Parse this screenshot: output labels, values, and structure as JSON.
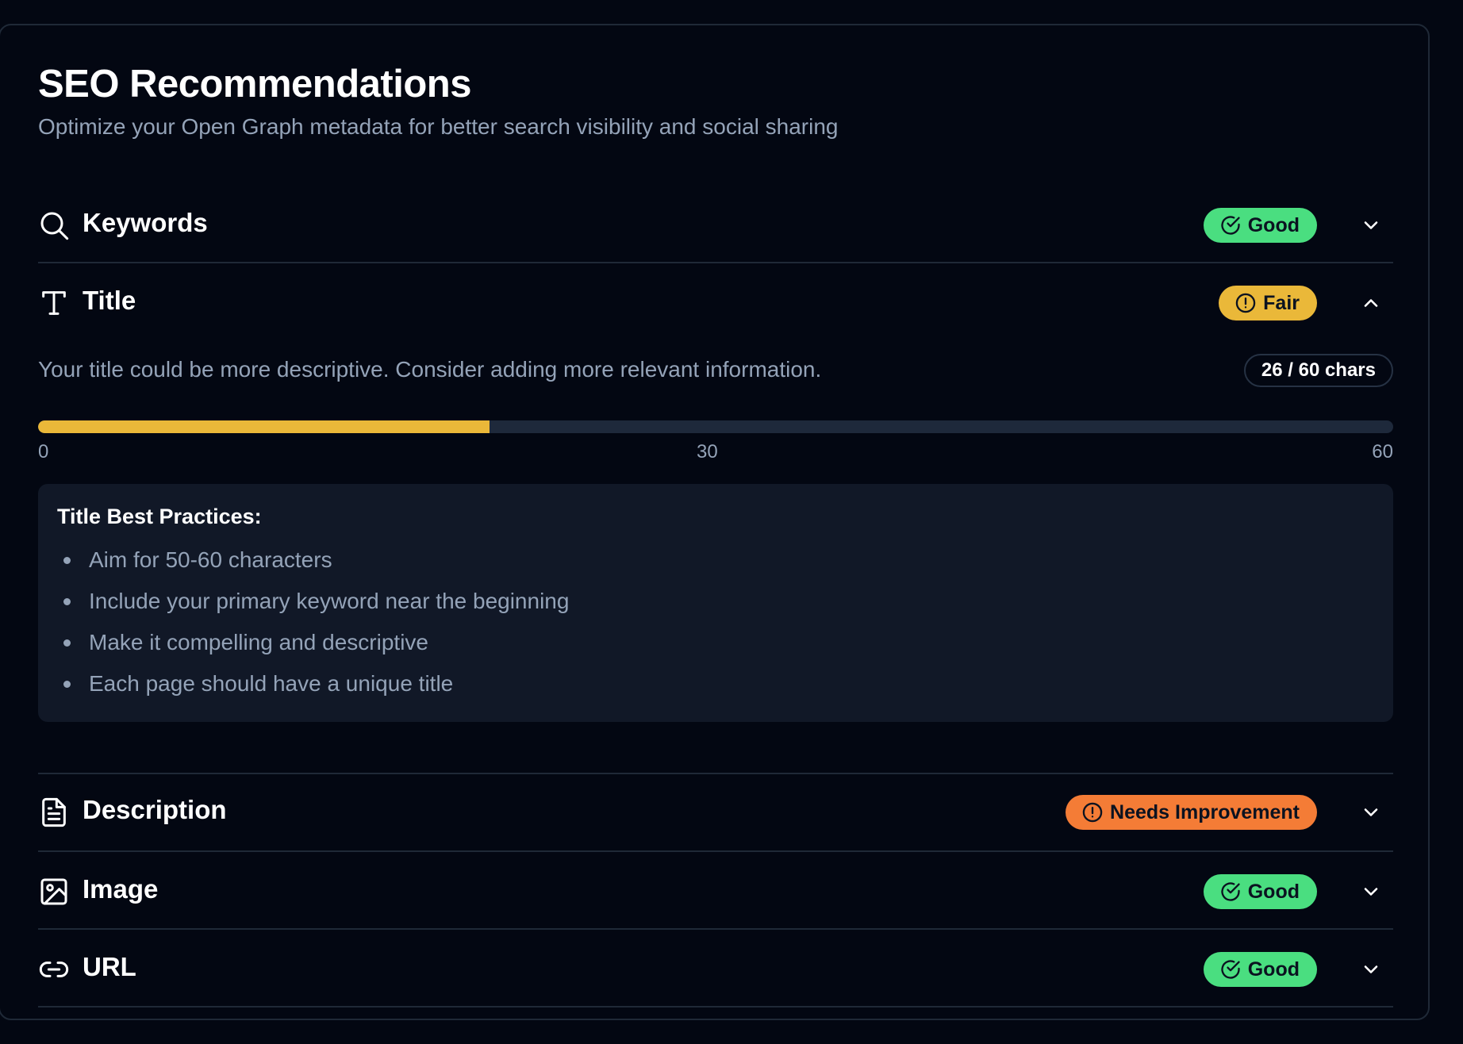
{
  "header": {
    "title": "SEO Recommendations",
    "subtitle": "Optimize your Open Graph metadata for better search visibility and social sharing"
  },
  "colors": {
    "good": "#4ade80",
    "fair": "#eab839",
    "needs_improvement": "#f47c36",
    "background": "#030712",
    "panel": "#111827"
  },
  "sections": [
    {
      "label": "Keywords",
      "icon": "search-icon",
      "status": "Good",
      "status_icon": "check-circle-icon",
      "expanded": false
    },
    {
      "label": "Title",
      "icon": "text-icon",
      "status": "Fair",
      "status_icon": "alert-circle-icon",
      "expanded": true
    },
    {
      "label": "Description",
      "icon": "document-icon",
      "status": "Needs Improvement",
      "status_icon": "alert-circle-icon",
      "expanded": false
    },
    {
      "label": "Image",
      "icon": "image-icon",
      "status": "Good",
      "status_icon": "check-circle-icon",
      "expanded": false
    },
    {
      "label": "URL",
      "icon": "link-icon",
      "status": "Good",
      "status_icon": "check-circle-icon",
      "expanded": false
    }
  ],
  "title_details": {
    "message": "Your title could be more descriptive. Consider adding more relevant information.",
    "char_count": "26 / 60 chars",
    "progress_fraction": 0.333,
    "scale": [
      "0",
      "30",
      "60"
    ],
    "practices_title": "Title Best Practices:",
    "practices": [
      "Aim for 50-60 characters",
      "Include your primary keyword near the beginning",
      "Make it compelling and descriptive",
      "Each page should have a unique title"
    ]
  }
}
